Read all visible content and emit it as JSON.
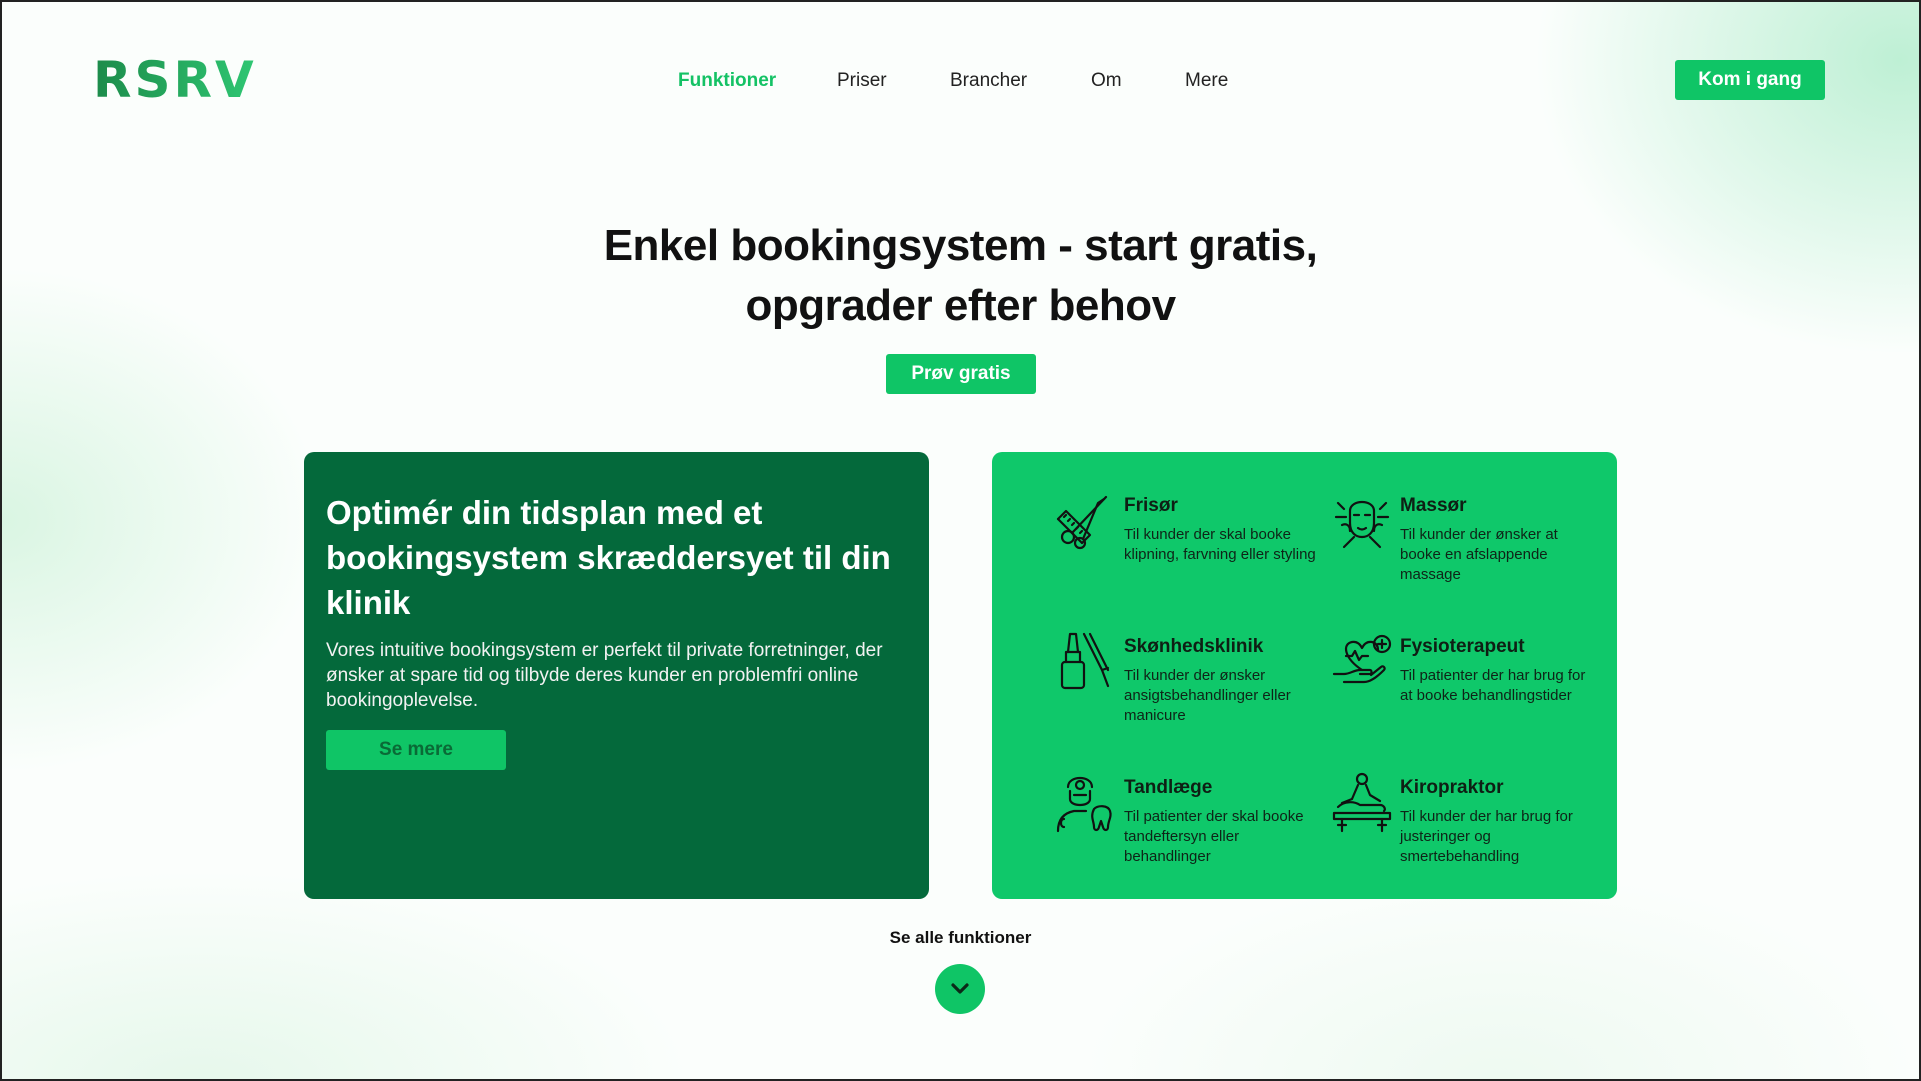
{
  "header": {
    "logo": "RSRV",
    "nav": [
      {
        "label": "Funktioner",
        "active": true
      },
      {
        "label": "Priser",
        "active": false
      },
      {
        "label": "Brancher",
        "active": false
      },
      {
        "label": "Om",
        "active": false
      },
      {
        "label": "Mere",
        "active": false
      }
    ],
    "cta_label": "Kom i gang"
  },
  "hero": {
    "title_line1": "Enkel bookingsystem - start gratis,",
    "title_line2": "opgrader efter behov",
    "cta_label": "Prøv gratis"
  },
  "feature_card": {
    "title": "Optimér din tidsplan med et bookingsystem skræddersyet til din klinik",
    "body": "Vores intuitive bookingsystem er perfekt til private forretninger, der ønsker at spare tid og tilbyde deres kunder en problemfri online bookingoplevelse.",
    "button_label": "Se mere"
  },
  "industries": [
    {
      "title": "Frisør",
      "desc": "Til kunder der skal booke klipning, farvning eller styling",
      "icon": "scissors-comb-icon"
    },
    {
      "title": "Massør",
      "desc": "Til kunder der ønsker at booke en afslappende massage",
      "icon": "face-massage-icon"
    },
    {
      "title": "Skønhedsklinik",
      "desc": "Til kunder der ønsker ansigtsbehandlinger eller manicure",
      "icon": "nail-polish-icon"
    },
    {
      "title": "Fysioterapeut",
      "desc": "Til patienter der har brug for at booke behandlingstider",
      "icon": "heart-hand-icon"
    },
    {
      "title": "Tandlæge",
      "desc": "Til patienter der skal booke tandeftersyn eller behandlinger",
      "icon": "dentist-icon"
    },
    {
      "title": "Kiropraktor",
      "desc": "Til kunder der har brug for justeringer og smertebehandling",
      "icon": "chiropractic-table-icon"
    }
  ],
  "footer": {
    "see_all_label": "Se alle funktioner",
    "down_icon": "chevron-down-icon"
  },
  "colors": {
    "brand_green": "#0fc566",
    "dark_green": "#04693b",
    "card_green": "#0fc86a"
  }
}
